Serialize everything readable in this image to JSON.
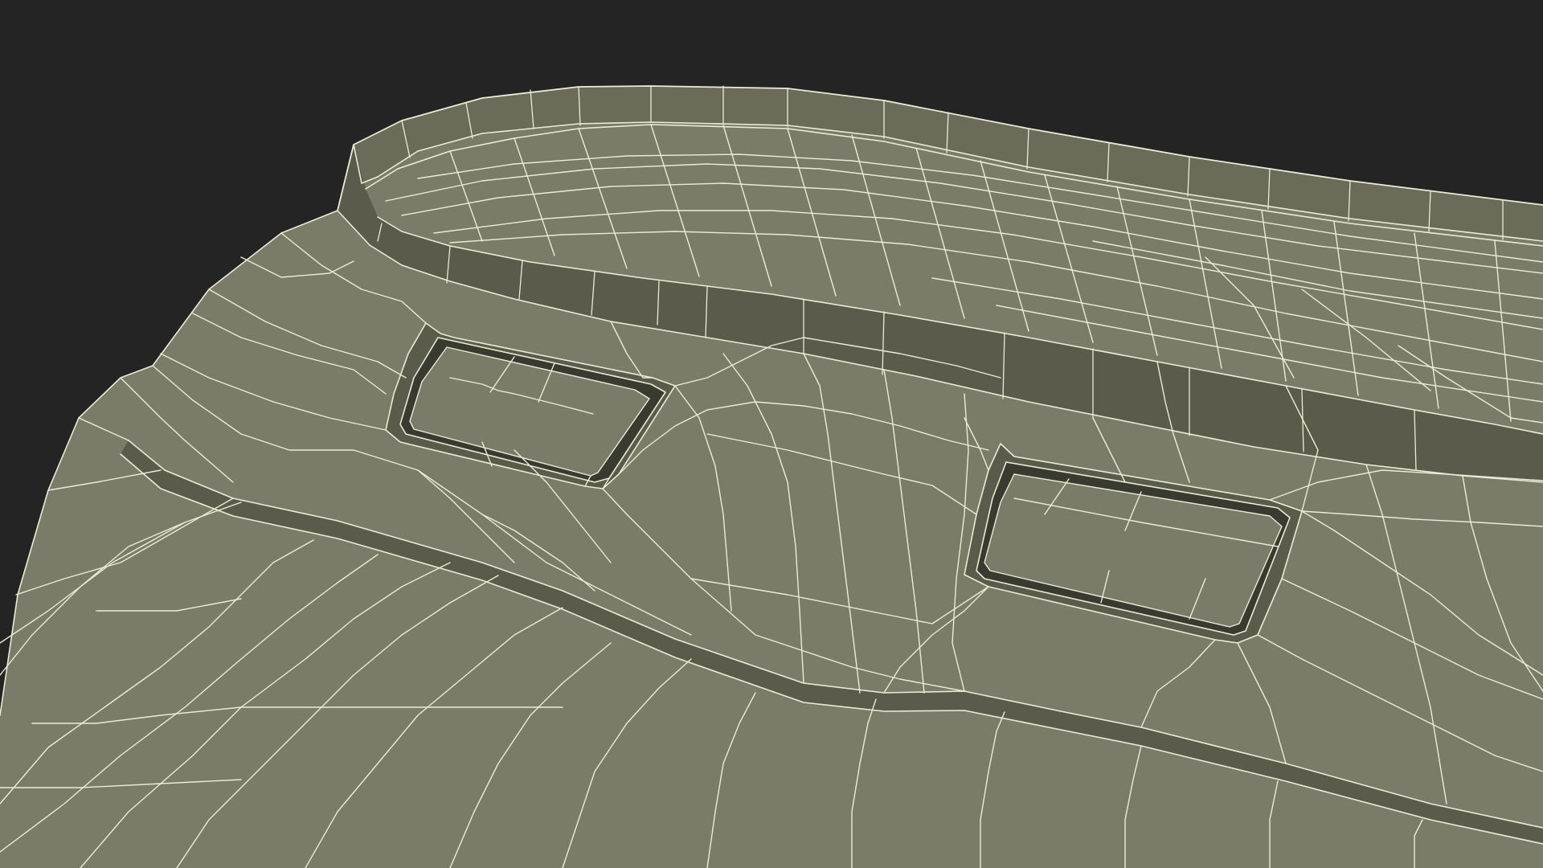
{
  "scene": {
    "background_color": "#242424",
    "surface_color": "#7a7b68",
    "surface_shade_color": "#6a6b59",
    "surface_dark_color": "#5a5b4b",
    "recess_color": "#3a3b30",
    "wire_color": "#ecebd6"
  }
}
